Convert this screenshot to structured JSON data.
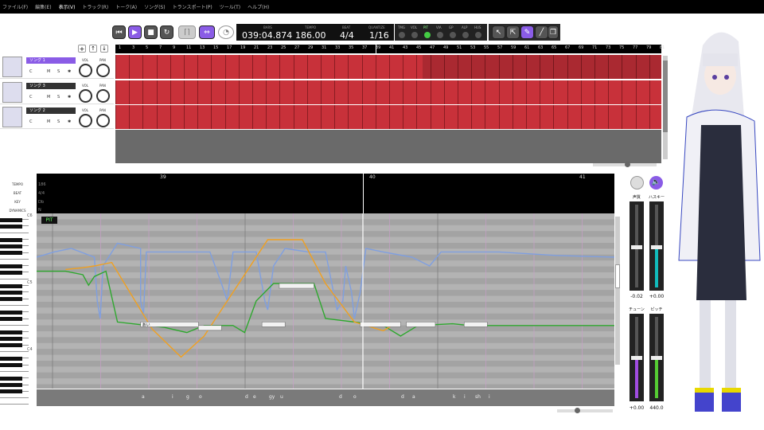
{
  "menu": [
    "ファイル(F)",
    "編集(E)",
    "表示(V)",
    "トラック(R)",
    "トーク(A)",
    "ソング(S)",
    "トランスポート(P)",
    "ツール(T)",
    "ヘルプ(H)"
  ],
  "menu_selected_index": 2,
  "transport": {
    "bars_caption": "BARS",
    "time": "039:04.874",
    "tempo_caption": "TEMPO",
    "tempo": "186.00",
    "beat_caption": "BEAT",
    "beat": "4/4",
    "quantize_caption": "QUANTIZE",
    "quantize": "1/16"
  },
  "track_params": [
    "TMG",
    "VOL",
    "PIT",
    "VIA",
    "GP",
    "ALP",
    "HUS"
  ],
  "track_params_active": "PIT",
  "tracks": [
    {
      "name": "ソング 1",
      "selected": true,
      "c": "C",
      "m": "M",
      "s": "S",
      "vol_label": "VOL",
      "pan_label": "PAN"
    },
    {
      "name": "ソング 3",
      "selected": false,
      "c": "C",
      "m": "M",
      "s": "S",
      "vol_label": "VOL",
      "pan_label": "PAN"
    },
    {
      "name": "ソング 2",
      "selected": false,
      "c": "C",
      "m": "M",
      "s": "S",
      "vol_label": "VOL",
      "pan_label": "PAN"
    }
  ],
  "arranger_ruler": [
    1,
    3,
    5,
    7,
    9,
    11,
    13,
    15,
    17,
    19,
    21,
    23,
    25,
    27,
    29,
    31,
    33,
    35,
    37,
    39,
    41,
    43,
    45,
    47,
    49,
    51,
    53,
    55,
    57,
    59,
    61,
    63,
    65,
    67,
    69,
    71,
    73,
    75,
    77,
    79,
    81
  ],
  "editor_ruler": [
    "39",
    "40",
    "41"
  ],
  "editor_labels": {
    "tempo": "TEMPO",
    "beat": "BEAT",
    "key": "KEY",
    "dynamics": "DYNAMICS"
  },
  "editor_values": {
    "tempo": "186",
    "beat": "4/4",
    "key": "Db",
    "dynamics": "N"
  },
  "piano_labels": [
    "C6",
    "C5",
    "C4"
  ],
  "pit_badge": "PIT",
  "notes": [
    {
      "lyric": "あい",
      "start": 0.18,
      "pitch": 0.62,
      "len": 0.1
    },
    {
      "lyric": "",
      "start": 0.28,
      "pitch": 0.64,
      "len": 0.04
    },
    {
      "lyric": "",
      "start": 0.39,
      "pitch": 0.62,
      "len": 0.04
    },
    {
      "lyric": "",
      "start": 0.42,
      "pitch": 0.4,
      "len": 0.06
    },
    {
      "lyric": "",
      "start": 0.56,
      "pitch": 0.62,
      "len": 0.07
    },
    {
      "lyric": "",
      "start": 0.64,
      "pitch": 0.62,
      "len": 0.05
    },
    {
      "lyric": "",
      "start": 0.74,
      "pitch": 0.62,
      "len": 0.04
    }
  ],
  "phonemes": [
    "a",
    "i",
    "g",
    "o",
    "d",
    "e",
    "gy",
    "u",
    "d",
    "o",
    "d",
    "a",
    "k",
    "i",
    "sh",
    "i"
  ],
  "params": {
    "voice_label": "声質",
    "husky_label": "ハスキー",
    "voice_value": "-0.02",
    "husky_value": "+0.00",
    "tune_label": "チューン",
    "pitch_label": "ピッチ",
    "tune_value": "+0.00",
    "pitch_value": "440.0"
  },
  "colors": {
    "accent": "#8a5ce6",
    "lane": "#c8313a",
    "pitch_green": "#2fa82f",
    "pitch_orange": "#f0a020",
    "pitch_blue": "#7f9fe0"
  }
}
